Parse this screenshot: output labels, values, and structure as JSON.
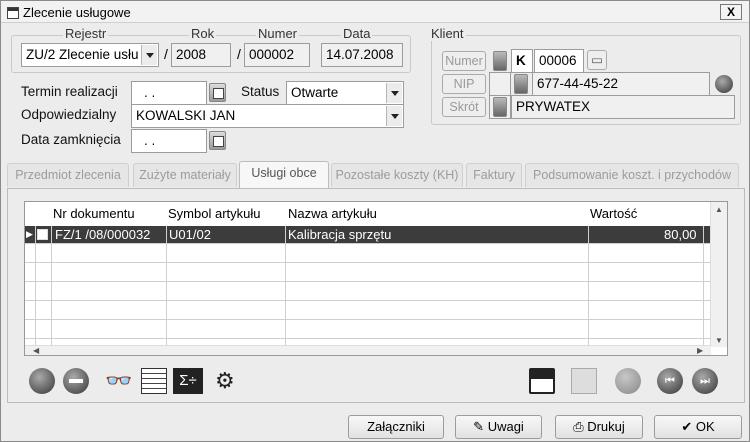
{
  "window": {
    "title": "Zlecenie usługowe",
    "close_glyph": "X"
  },
  "header": {
    "rejestr_label": "Rejestr",
    "rok_label": "Rok",
    "numer_label": "Numer",
    "data_label": "Data",
    "rejestr_value": "ZU/2  Zlecenie usłu",
    "rok_value": "2008",
    "numer_value": "000002",
    "data_value": "14.07.2008",
    "sep": "/"
  },
  "form": {
    "termin_label": "Termin realizacji",
    "termin_value": ". .",
    "status_label": "Status",
    "status_value": "Otwarte",
    "odpowiedzialny_label": "Odpowiedzialny",
    "odpowiedzialny_value": "KOWALSKI JAN",
    "data_zamkniecia_label": "Data zamknięcia",
    "data_zamkniecia_value": ". ."
  },
  "client": {
    "group_label": "Klient",
    "numer_btn": "Numer",
    "nip_btn": "NIP",
    "skrot_btn": "Skrót",
    "type_letter": "K",
    "numer_value": "00006",
    "nip_value": "677-44-45-22",
    "skrot_value": "PRYWATEX"
  },
  "tabs": [
    {
      "label": "Przedmiot zlecenia"
    },
    {
      "label": "Zużyte materiały"
    },
    {
      "label": "Usługi obce"
    },
    {
      "label": "Pozostałe koszty (KH)"
    },
    {
      "label": "Faktury"
    },
    {
      "label": "Podsumowanie koszt. i przychodów"
    }
  ],
  "grid": {
    "columns": [
      "Nr dokumentu",
      "Symbol artykułu",
      "Nazwa artykułu",
      "Wartość"
    ],
    "rows": [
      {
        "nr": "FZ/1  /08/000032",
        "symbol": "U01/02",
        "nazwa": "Kalibracja sprzętu",
        "wartosc": "80,00"
      }
    ]
  },
  "toolbar_icons": [
    "add-icon",
    "remove-icon",
    "binoculars-icon",
    "table-view-icon",
    "sum-icon",
    "settings-icon",
    "save-icon",
    "copy-icon",
    "refresh-icon",
    "prev-icon",
    "next-icon"
  ],
  "buttons": {
    "zalaczniki": "Załączniki",
    "uwagi": "Uwagi",
    "drukuj": "Drukuj",
    "ok": "OK"
  }
}
